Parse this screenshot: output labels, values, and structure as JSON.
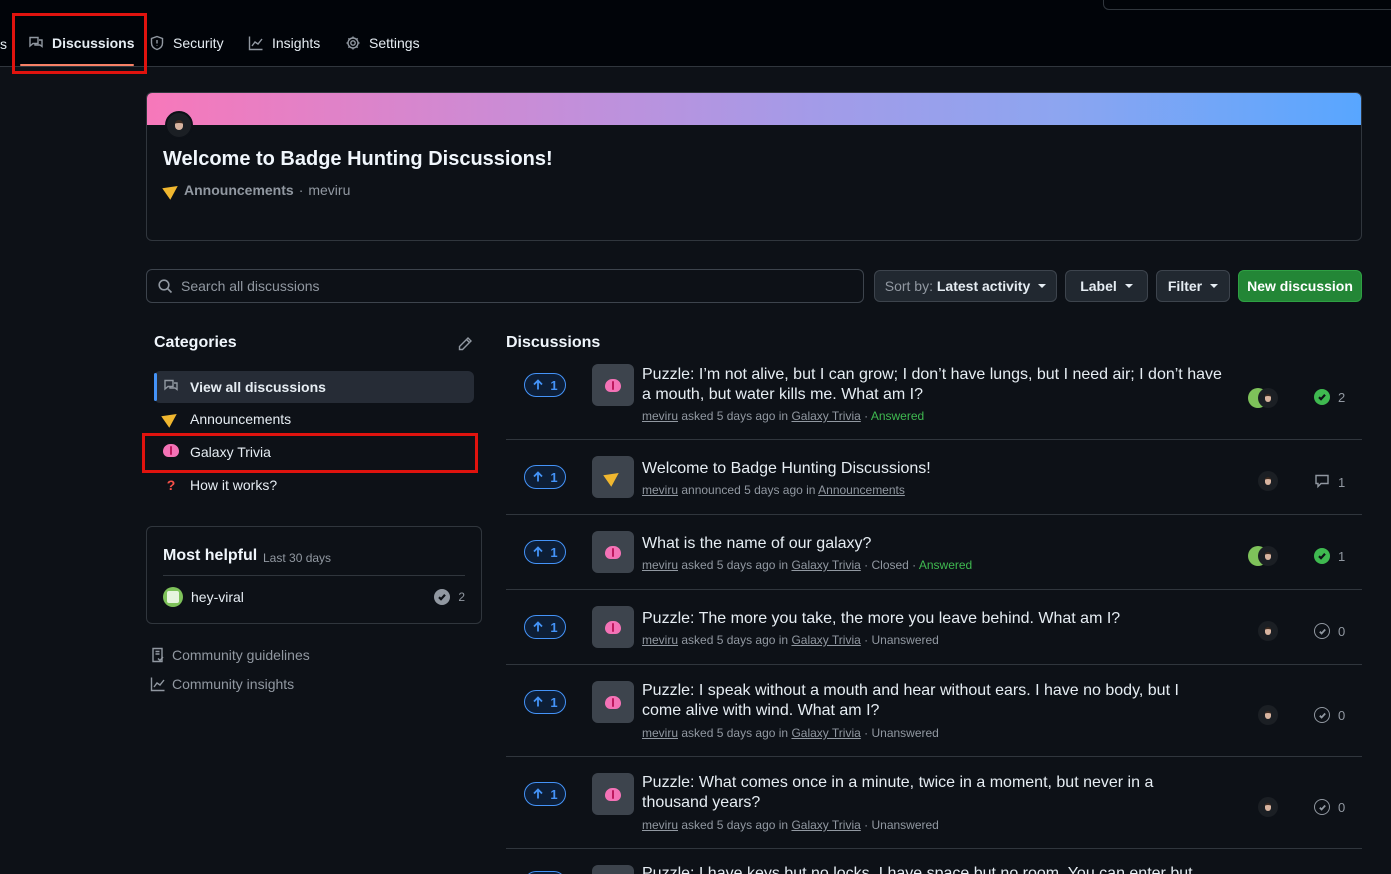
{
  "nav": {
    "cut_left": "s",
    "tabs": [
      {
        "label": "Discussions",
        "icon": "comment-discussion-icon"
      },
      {
        "label": "Security",
        "icon": "shield-icon"
      },
      {
        "label": "Insights",
        "icon": "graph-icon"
      },
      {
        "label": "Settings",
        "icon": "gear-icon"
      }
    ]
  },
  "hero": {
    "title": "Welcome to Badge Hunting Discussions!",
    "category": "Announcements",
    "separator": "·",
    "author": "meviru"
  },
  "toolbar": {
    "search_placeholder": "Search all discussions",
    "sort_prefix": "Sort by:",
    "sort_value": "Latest activity",
    "label_btn": "Label",
    "filter_btn": "Filter",
    "new_btn": "New discussion"
  },
  "categories": {
    "heading": "Categories",
    "items": [
      {
        "label": "View all discussions",
        "icon": "comment-discussion-icon"
      },
      {
        "label": "Announcements",
        "icon": "loudspeaker-icon"
      },
      {
        "label": "Galaxy Trivia",
        "icon": "brain-icon"
      },
      {
        "label": "How it works?",
        "icon": "question-mark-icon"
      }
    ]
  },
  "helpful": {
    "title": "Most helpful",
    "subtitle": "Last 30 days",
    "user": "hey-viral",
    "count": "2"
  },
  "side_links": {
    "guidelines": "Community guidelines",
    "insights": "Community insights"
  },
  "discussions": {
    "heading": "Discussions",
    "rows": [
      {
        "votes": "1",
        "title": "Puzzle: I’m not alive, but I can grow; I don’t have lungs, but I need air; I don’t have a mouth, but water kills me. What am I?",
        "author": "meviru",
        "verb": "asked 5 days ago in",
        "category": "Galaxy Trivia",
        "status": "Answered",
        "count": "2"
      },
      {
        "votes": "1",
        "title": "Welcome to Badge Hunting Discussions!",
        "author": "meviru",
        "verb": "announced 5 days ago in",
        "category": "Announcements",
        "status": "",
        "count": "1"
      },
      {
        "votes": "1",
        "title": "What is the name of our galaxy?",
        "author": "meviru",
        "verb": "asked 5 days ago in",
        "category": "Galaxy Trivia",
        "closed": "Closed",
        "status": "Answered",
        "count": "1"
      },
      {
        "votes": "1",
        "title": "Puzzle: The more you take, the more you leave behind. What am I?",
        "author": "meviru",
        "verb": "asked 5 days ago in",
        "category": "Galaxy Trivia",
        "status": "Unanswered",
        "count": "0"
      },
      {
        "votes": "1",
        "title": "Puzzle: I speak without a mouth and hear without ears. I have no body, but I come alive with wind. What am I?",
        "author": "meviru",
        "verb": "asked 5 days ago in",
        "category": "Galaxy Trivia",
        "status": "Unanswered",
        "count": "0"
      },
      {
        "votes": "1",
        "title": "Puzzle: What comes once in a minute, twice in a moment, but never in a thousand years?",
        "author": "meviru",
        "verb": "asked 5 days ago in",
        "category": "Galaxy Trivia",
        "status": "Unanswered",
        "count": "0"
      },
      {
        "title": "Puzzle: I have keys but no locks. I have space but no room. You can enter but"
      }
    ]
  },
  "colors": {
    "accent": "#4493f8",
    "success": "#3fb950",
    "primary_button": "#238636",
    "highlight_box": "#e0130e"
  }
}
